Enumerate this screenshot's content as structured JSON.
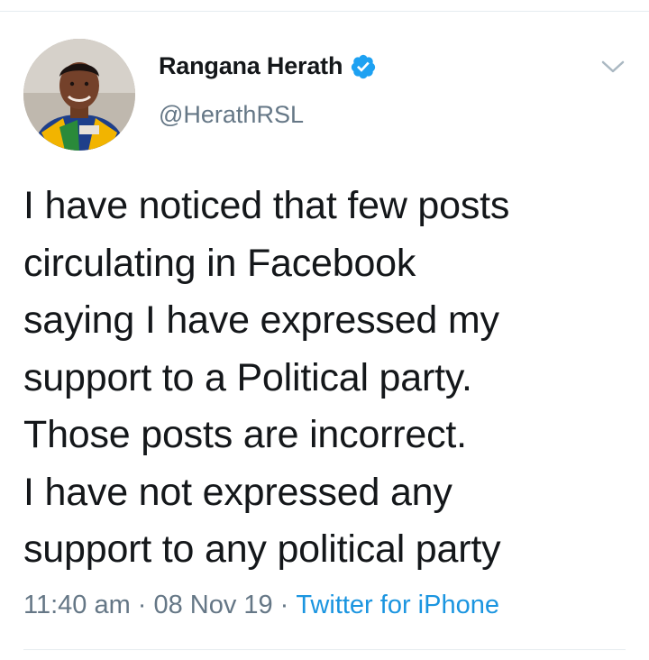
{
  "user": {
    "name": "Rangana Herath",
    "handle": "@HerathRSL",
    "verified": true,
    "avatar_icon": "profile-photo"
  },
  "tweet": {
    "text": "I have noticed that few posts\ncirculating in Facebook\nsaying I have expressed my\nsupport to a Political party.\nThose posts are incorrect.\nI have not expressed any\nsupport to any political party"
  },
  "meta": {
    "time": "11:40 am",
    "separator": "·",
    "date": "08 Nov 19",
    "source": "Twitter for iPhone"
  },
  "colors": {
    "verified_blue": "#1da1f2",
    "link_blue": "#1b95e0",
    "secondary_text": "#657786",
    "primary_text": "#14171a"
  }
}
